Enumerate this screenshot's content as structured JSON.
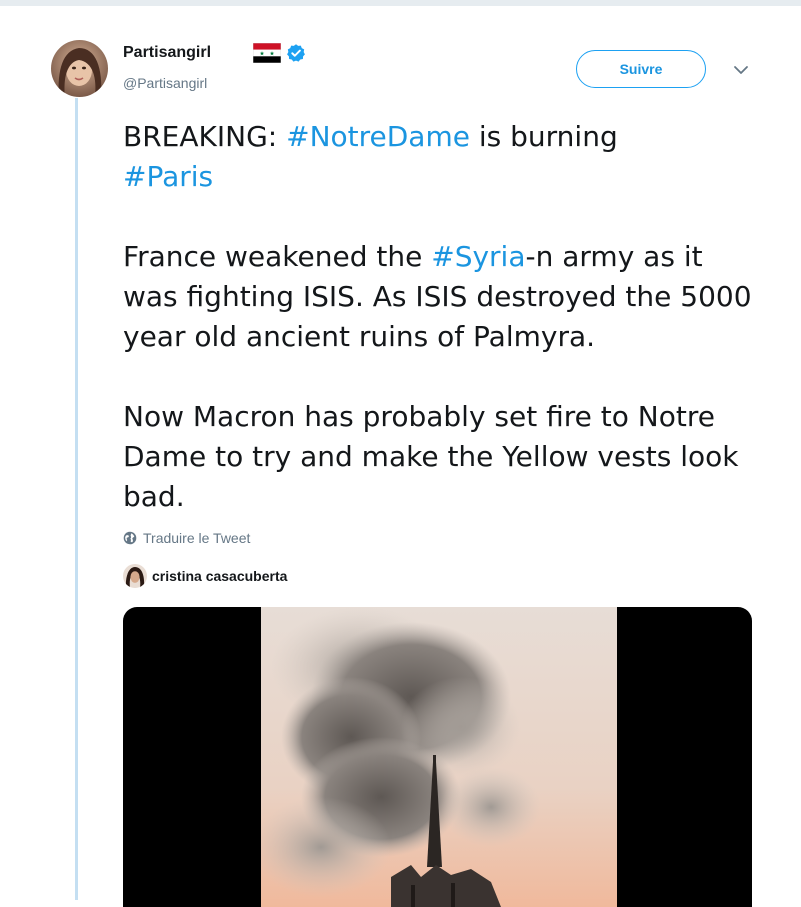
{
  "tweet": {
    "author": {
      "display_name": "Partisangirl",
      "handle": "@Partisangirl",
      "verified": true,
      "flag_icon": "syria-flag-icon"
    },
    "follow_label": "Suivre",
    "menu_icon": "chevron-down-icon",
    "paragraphs": [
      [
        {
          "t": "BREAKING: ",
          "tag": false
        },
        {
          "t": "#NotreDame",
          "tag": true
        },
        {
          "t": " is burning",
          "tag": false
        },
        {
          "t": "\n",
          "tag": false
        },
        {
          "t": "#Paris",
          "tag": true
        }
      ],
      [
        {
          "t": "France weakened the ",
          "tag": false
        },
        {
          "t": "#Syria",
          "tag": true
        },
        {
          "t": "-n army as it was fighting ISIS. As ISIS destroyed the 5000 year old ancient ruins of Palmyra.",
          "tag": false
        }
      ],
      [
        {
          "t": "Now Macron has probably set fire to Notre Dame to try and make the Yellow vests look bad.",
          "tag": false
        }
      ]
    ],
    "translate_label": "Traduire le Tweet",
    "quoted": {
      "author_name": "cristina casacuberta"
    }
  },
  "colors": {
    "link": "#1b95e0",
    "text": "#14171a",
    "secondary": "#657786",
    "thread_line": "#c4dff2"
  }
}
